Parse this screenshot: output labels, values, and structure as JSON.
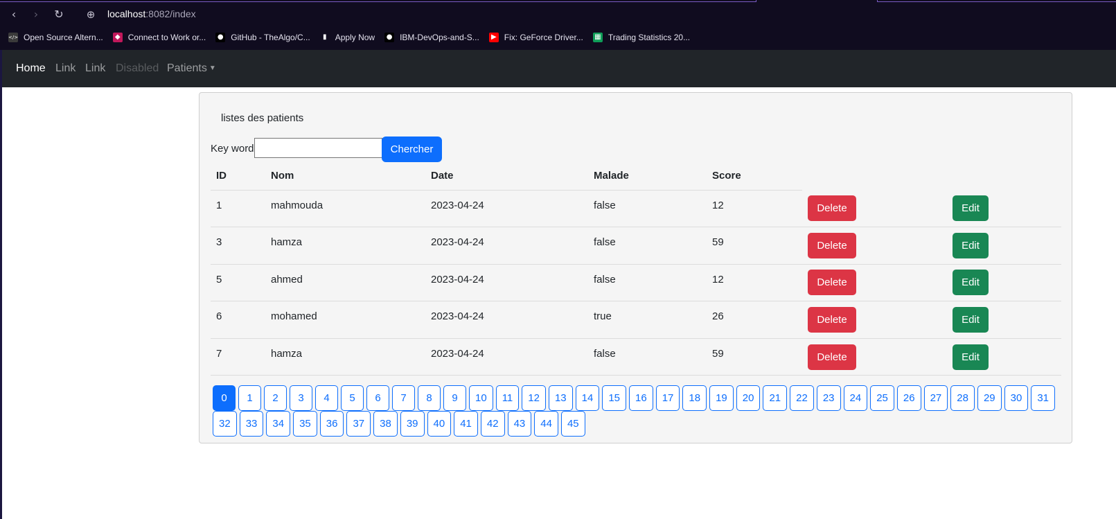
{
  "browser": {
    "url_host": "localhost",
    "url_rest": ":8082/index",
    "bookmarks": [
      {
        "label": "Open Source Altern...",
        "icon": "code-icon",
        "color": "#3a3a3a"
      },
      {
        "label": "Connect to Work or...",
        "icon": "bookmark-icon",
        "color": "#c2185b"
      },
      {
        "label": "GitHub - TheAlgo/C...",
        "icon": "github-icon",
        "color": "#000000"
      },
      {
        "label": "Apply Now",
        "icon": "file-icon",
        "color": "#ffffff"
      },
      {
        "label": "IBM-DevOps-and-S...",
        "icon": "github-icon",
        "color": "#000000"
      },
      {
        "label": "Fix: GeForce Driver...",
        "icon": "youtube-icon",
        "color": "#ff0000"
      },
      {
        "label": "Trading Statistics 20...",
        "icon": "sheets-icon",
        "color": "#0f9d58"
      }
    ]
  },
  "navbar": {
    "items": [
      {
        "label": "Home",
        "state": "active"
      },
      {
        "label": "Link",
        "state": "normal"
      },
      {
        "label": "Link",
        "state": "normal"
      },
      {
        "label": "Disabled",
        "state": "disabled"
      },
      {
        "label": "Patients",
        "state": "dropdown"
      }
    ]
  },
  "card": {
    "title": "listes des patients",
    "search": {
      "label": "Key word",
      "value": "",
      "button_label": "Chercher"
    },
    "table": {
      "headers": [
        "ID",
        "Nom",
        "Date",
        "Malade",
        "Score"
      ],
      "rows": [
        {
          "id": "1",
          "nom": "mahmouda",
          "date": "2023-04-24",
          "malade": "false",
          "score": "12"
        },
        {
          "id": "3",
          "nom": "hamza",
          "date": "2023-04-24",
          "malade": "false",
          "score": "59"
        },
        {
          "id": "5",
          "nom": "ahmed",
          "date": "2023-04-24",
          "malade": "false",
          "score": "12"
        },
        {
          "id": "6",
          "nom": "mohamed",
          "date": "2023-04-24",
          "malade": "true",
          "score": "26"
        },
        {
          "id": "7",
          "nom": "hamza",
          "date": "2023-04-24",
          "malade": "false",
          "score": "59"
        }
      ],
      "delete_label": "Delete",
      "edit_label": "Edit"
    },
    "pagination": {
      "current": "0",
      "pages": [
        "0",
        "1",
        "2",
        "3",
        "4",
        "5",
        "6",
        "7",
        "8",
        "9",
        "10",
        "11",
        "12",
        "13",
        "14",
        "15",
        "16",
        "17",
        "18",
        "19",
        "20",
        "21",
        "22",
        "23",
        "24",
        "25",
        "26",
        "27",
        "28",
        "29",
        "30",
        "31",
        "32",
        "33",
        "34",
        "35",
        "36",
        "37",
        "38",
        "39",
        "40",
        "41",
        "42",
        "43",
        "44",
        "45"
      ]
    }
  },
  "colors": {
    "primary": "#0d6efd",
    "danger": "#dc3545",
    "success": "#198754",
    "navbar_bg": "#212529",
    "browser_bg": "#100c1f"
  }
}
